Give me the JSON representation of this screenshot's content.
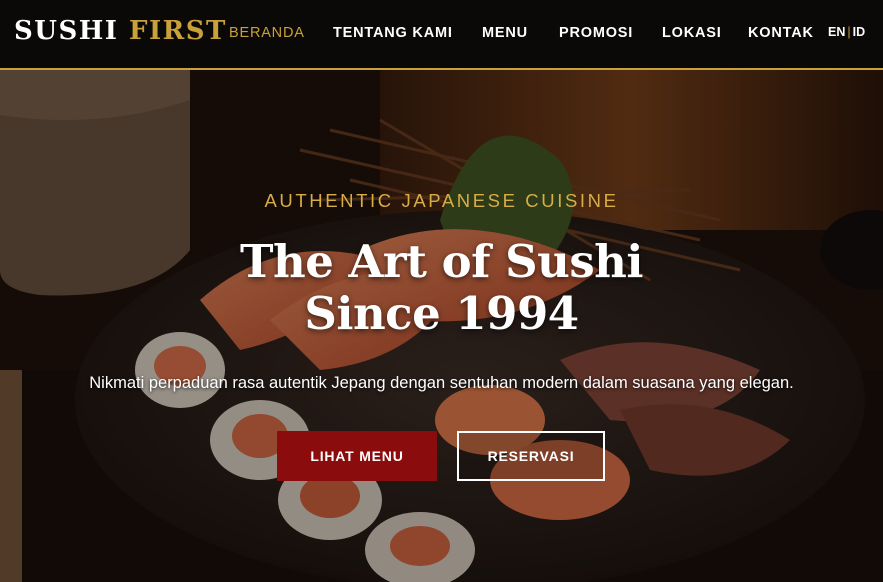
{
  "header": {
    "logo": {
      "primary": "SUSHI",
      "accent": "FIRST"
    },
    "nav": [
      {
        "label": "BERANDA",
        "active": true
      },
      {
        "label": "TENTANG KAMI",
        "active": false
      },
      {
        "label": "MENU",
        "active": false
      },
      {
        "label": "PROMOSI",
        "active": false
      },
      {
        "label": "LOKASI",
        "active": false
      },
      {
        "label": "KONTAK",
        "active": false
      }
    ],
    "languages": [
      "EN",
      "ID"
    ],
    "language_separator": "|"
  },
  "hero": {
    "tagline": "AUTHENTIC JAPANESE CUISINE",
    "title_line1": "The Art of Sushi",
    "title_line2": "Since 1994",
    "subtitle": "Nikmati perpaduan rasa autentik Jepang dengan sentuhan modern dalam suasana yang elegan.",
    "primary_button": "LIHAT MENU",
    "secondary_button": "RESERVASI",
    "background_image": "sushi-platter-photo"
  },
  "colors": {
    "accent_gold": "#c9a13b",
    "primary_red": "#8b0c0c",
    "header_bg": "#0b0907"
  }
}
